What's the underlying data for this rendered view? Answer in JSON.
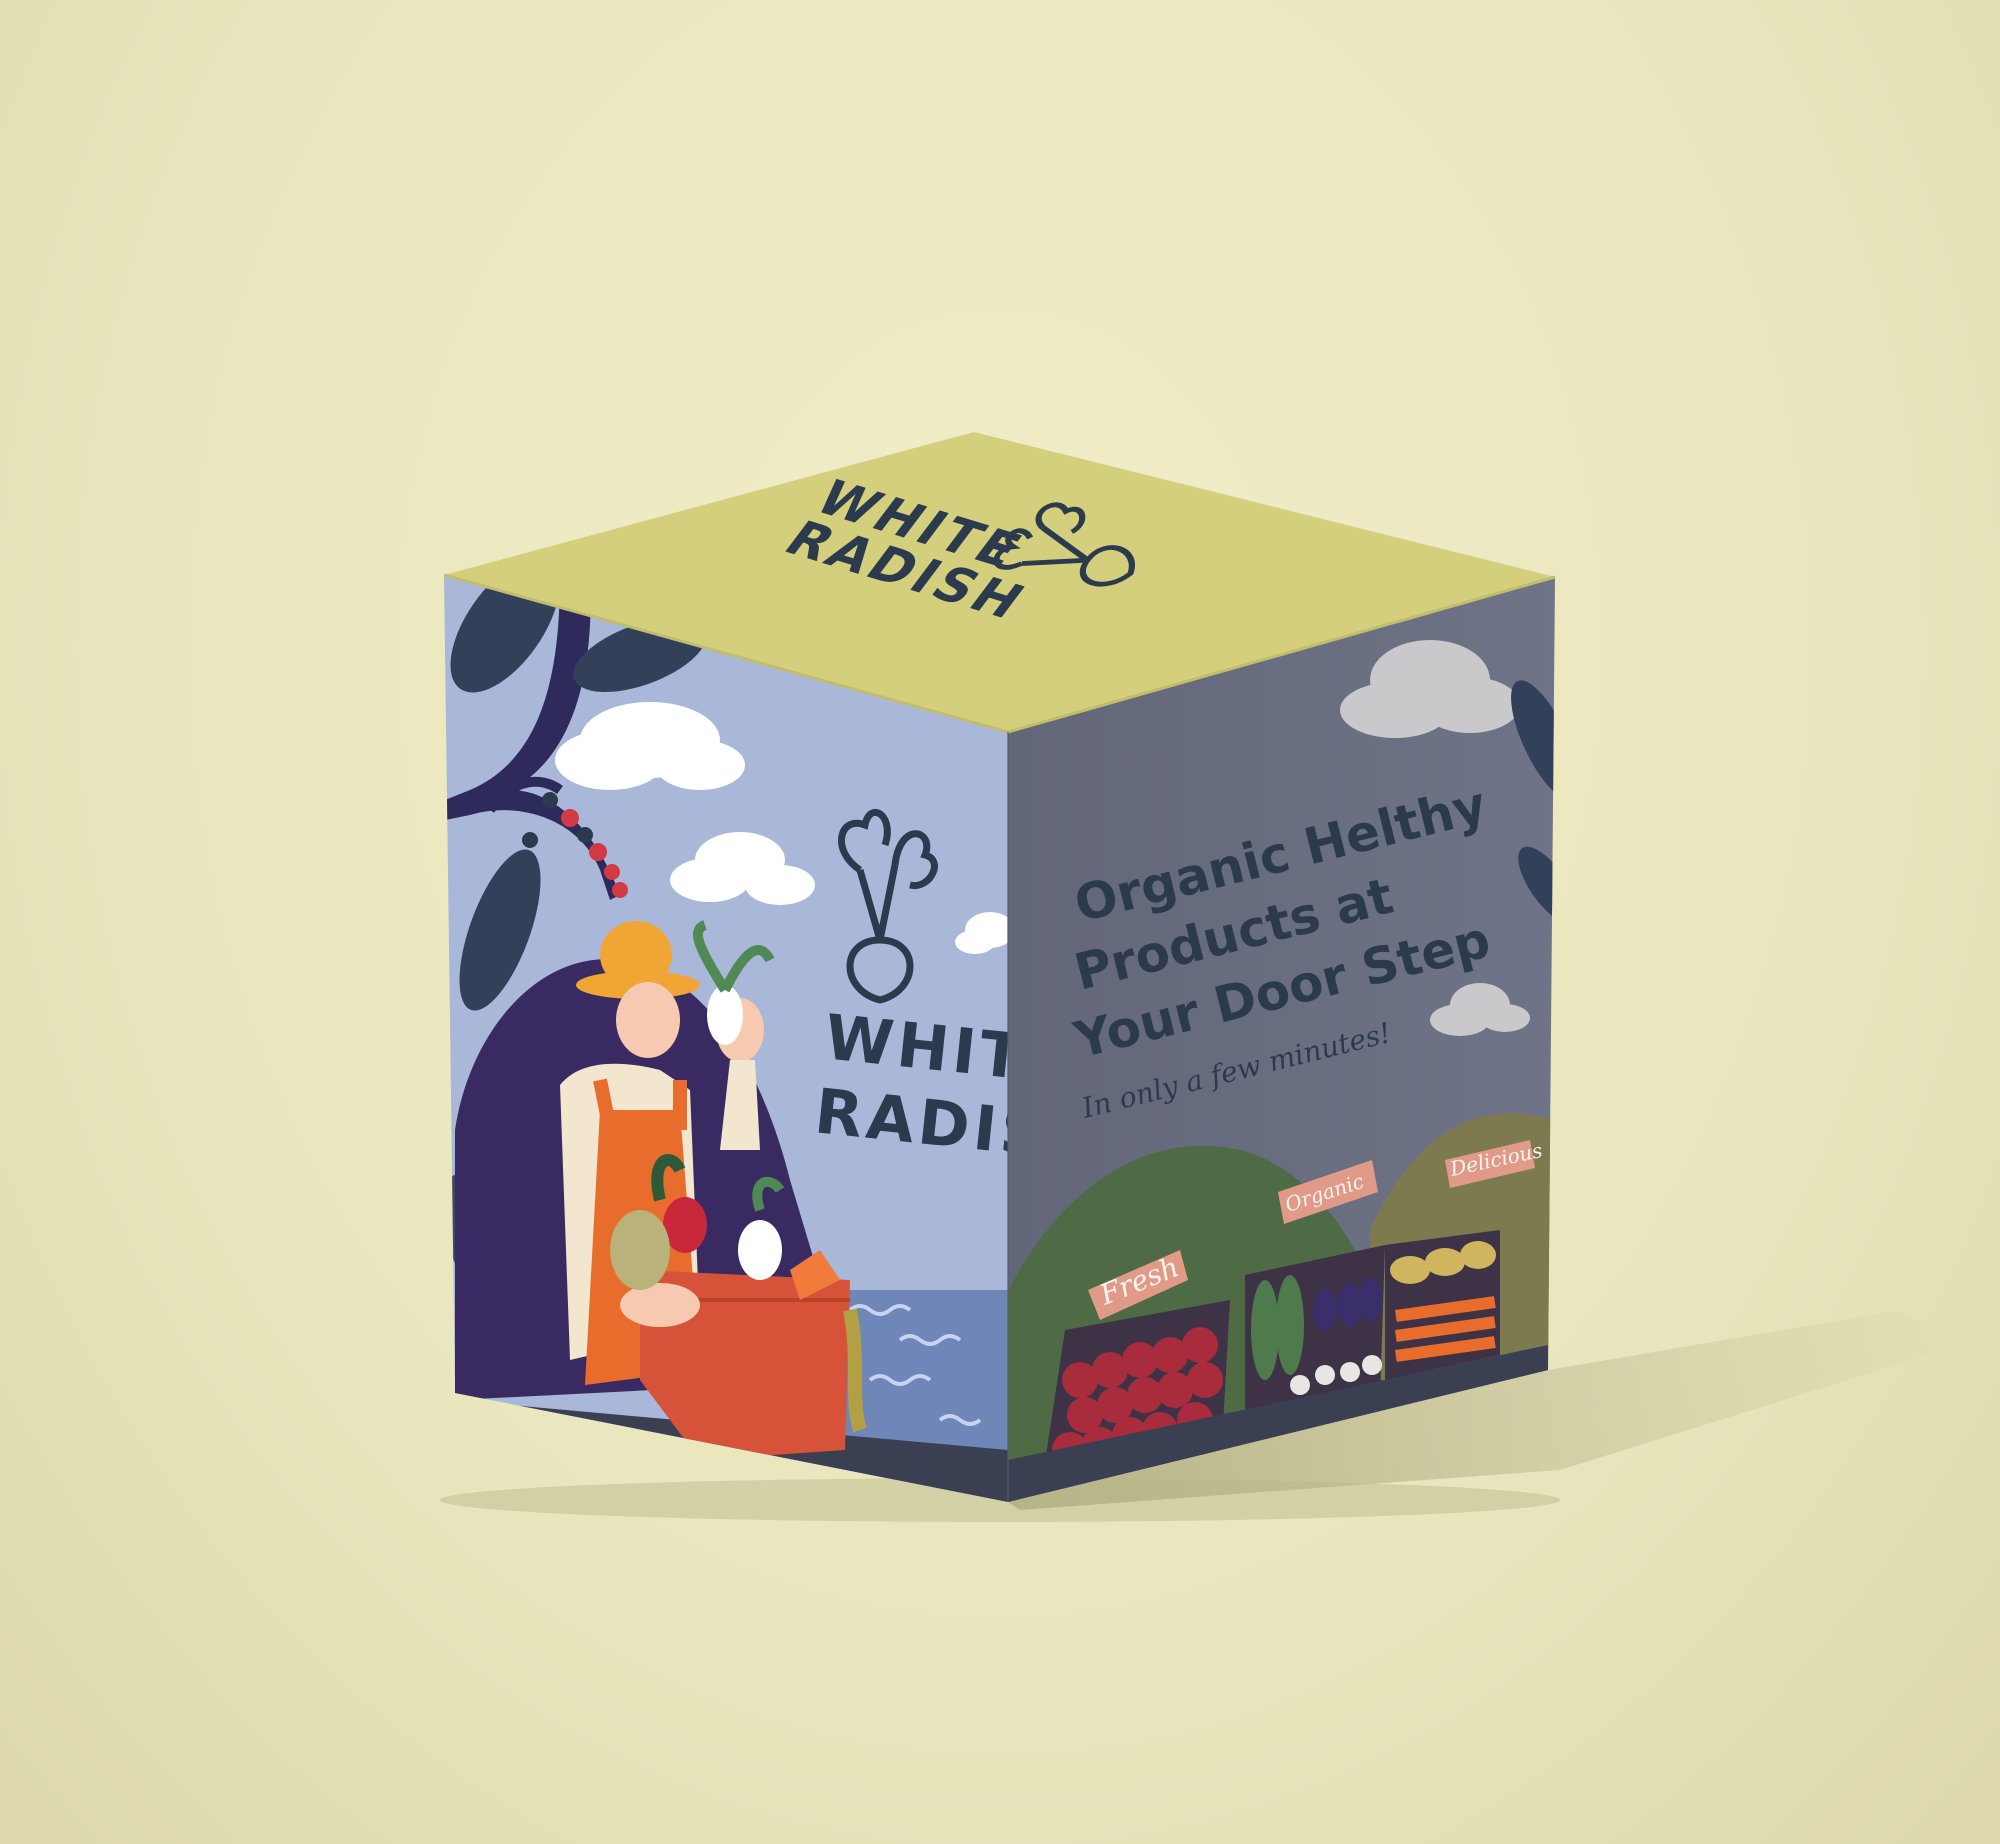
{
  "brand": {
    "line1": "WHITE",
    "line2": "RADISH"
  },
  "right_face": {
    "headline_line1": "Organic Helthy",
    "headline_line2": "Products at",
    "headline_line3": "Your Door Step",
    "tagline": "In only a few minutes!"
  },
  "market_signs": {
    "fresh": "Fresh",
    "organic": "Organic",
    "delicious": "Delicious"
  },
  "colors": {
    "background": "#ece9c0",
    "box_top": "#d4cf7c",
    "left_face_sky": "#a9b8d8",
    "right_face_sky": "#6f7488",
    "logo_navy": "#2c3a4e",
    "hill_purple": "#3a2a62",
    "hill_green": "#4f6b45"
  }
}
